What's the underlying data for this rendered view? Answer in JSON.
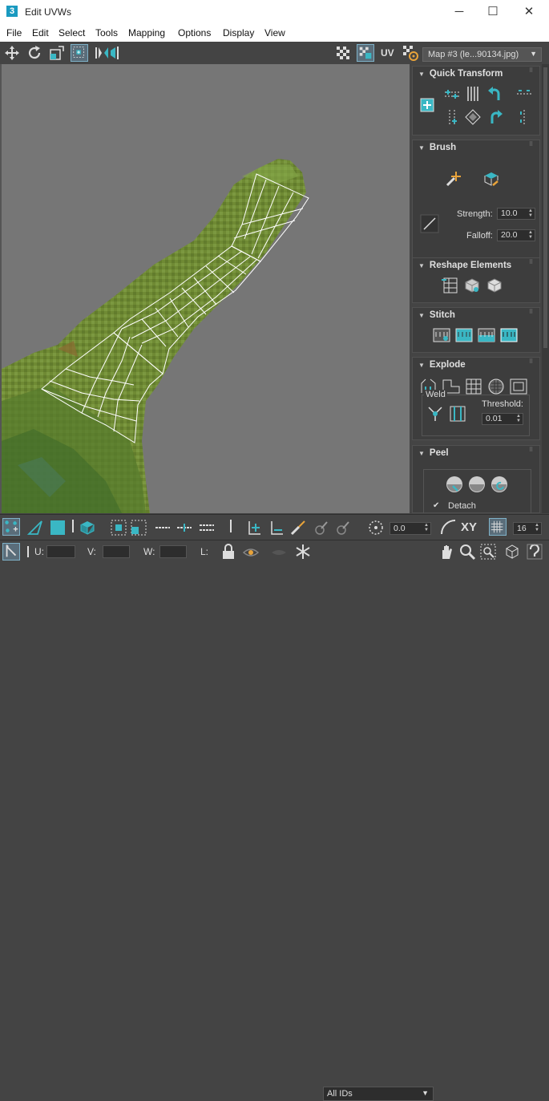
{
  "window": {
    "icon_label": "3",
    "title": "Edit UVWs",
    "minimize": "─",
    "maximize": "☐",
    "close": "✕"
  },
  "menu": [
    "File",
    "Edit",
    "Select",
    "Tools",
    "Mapping",
    "Options",
    "Display",
    "View"
  ],
  "toolbar": {
    "uv_label": "UV",
    "map_select": "Map #3 (le...90134.jpg)"
  },
  "panels": {
    "quick_transform": {
      "title": "Quick Transform"
    },
    "brush": {
      "title": "Brush",
      "strength_label": "Strength:",
      "strength_value": "10.0",
      "falloff_label": "Falloff:",
      "falloff_value": "20.0"
    },
    "reshape": {
      "title": "Reshape Elements"
    },
    "stitch": {
      "title": "Stitch"
    },
    "explode": {
      "title": "Explode",
      "weld_label": "Weld",
      "threshold_label": "Threshold:",
      "threshold_value": "0.01"
    },
    "peel": {
      "title": "Peel",
      "detach_label": "Detach",
      "detach_check": "✔"
    }
  },
  "bottom": {
    "angle_value": "0.0",
    "xy_label": "XY",
    "grid_value": "16",
    "u_label": "U:",
    "v_label": "V:",
    "w_label": "W:",
    "l_label": "L:",
    "ids_select": "All IDs"
  },
  "colors": {
    "accent": "#3ab7c4",
    "panel": "#444444",
    "viewport": "#767676",
    "uv_wire": "#ffffff",
    "leaf": "#6f8f35"
  }
}
